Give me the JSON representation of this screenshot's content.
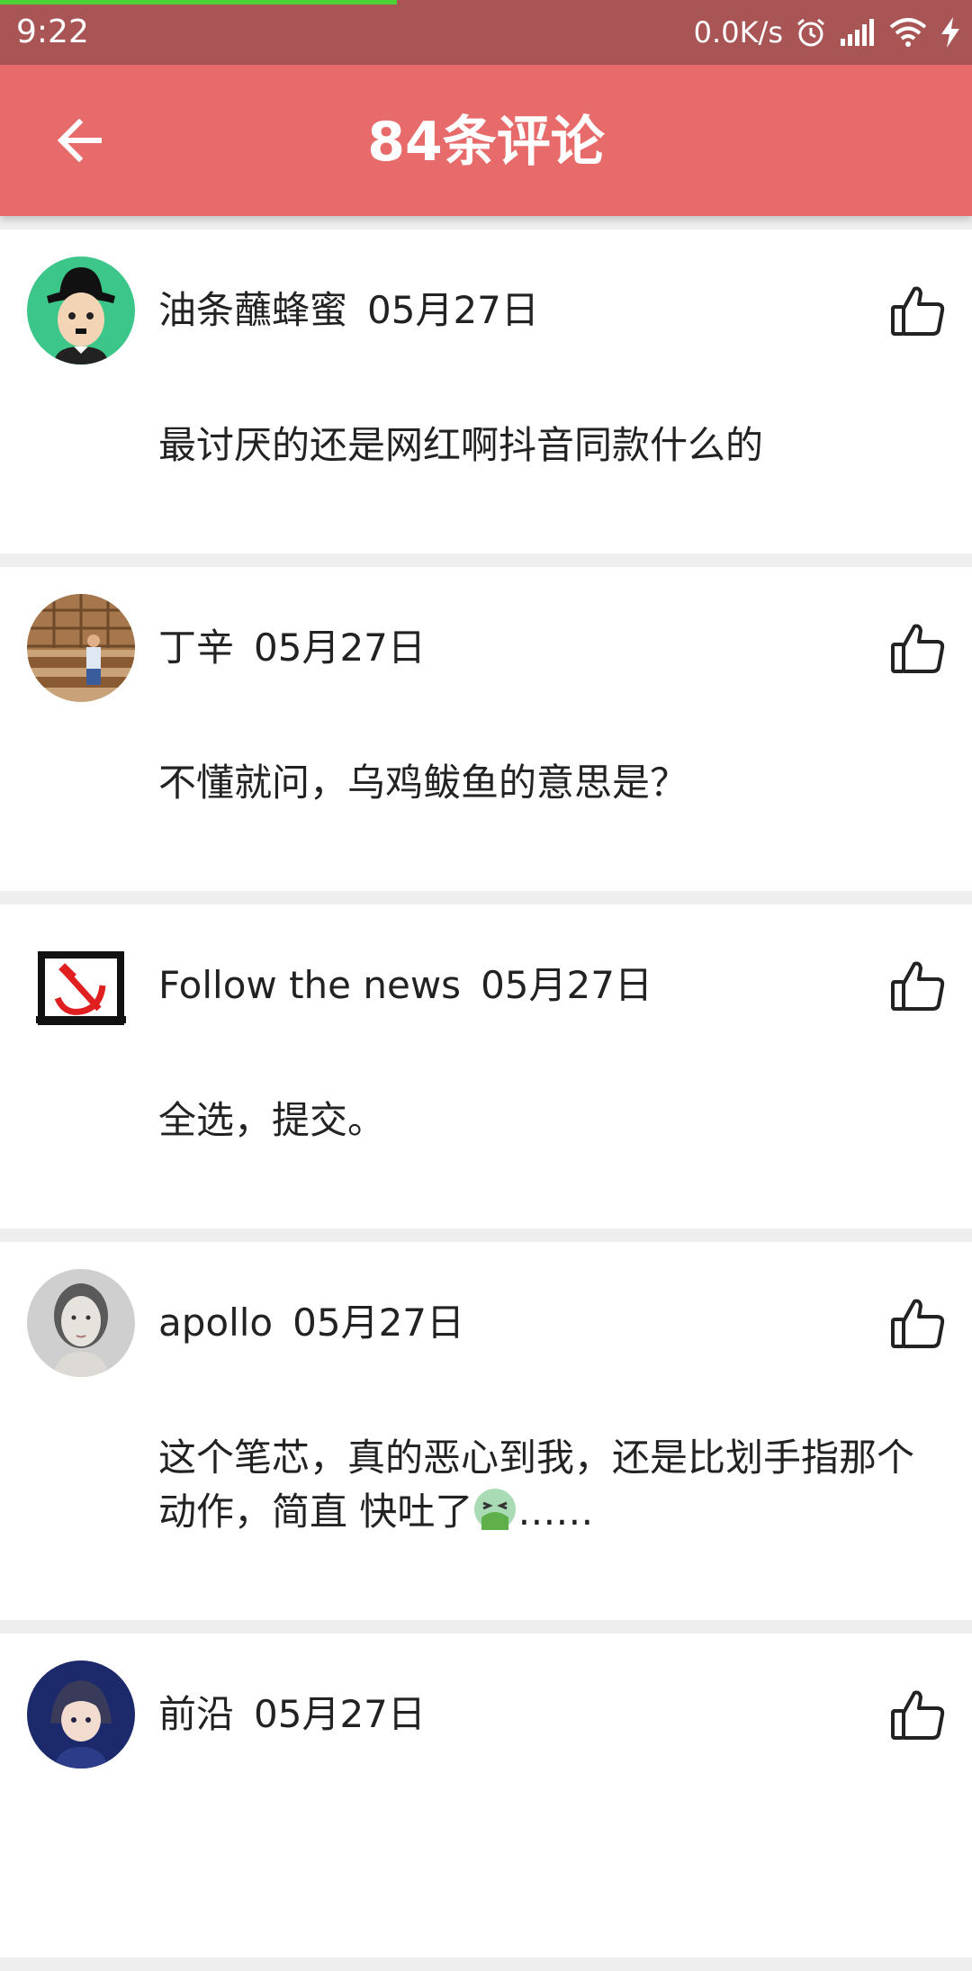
{
  "status_bar": {
    "time": "9:22",
    "net_speed": "0.0K/s",
    "icons": [
      "alarm-icon",
      "signal-icon",
      "wifi-icon",
      "charging-icon"
    ],
    "background": "#a95555"
  },
  "app_bar": {
    "title": "84条评论",
    "back_icon": "arrow-left-icon",
    "background": "#e76b6b"
  },
  "comments": [
    {
      "user": "油条蘸蜂蜜",
      "date": "05月27日",
      "text": "最讨厌的还是网红啊抖音同款什么的",
      "avatar": "cartoon-man-avatar"
    },
    {
      "user": "丁辛",
      "date": "05月27日",
      "text": "不懂就问，乌鸡鲅鱼的意思是？",
      "avatar": "bookshelf-photo-avatar"
    },
    {
      "user": "Follow the news",
      "date": "05月27日",
      "text": "全选，提交。",
      "avatar": "hammer-sickle-logo-avatar"
    },
    {
      "user": "apollo",
      "date": "05月27日",
      "text": "这个笔芯，真的恶心到我，还是比划手指那个动作，简直 快吐了",
      "text_suffix": "……",
      "emoji": "vomiting-face-emoji",
      "avatar": "woman-portrait-avatar"
    },
    {
      "user": "前沿",
      "date": "05月27日",
      "text": "",
      "avatar": "anime-character-avatar"
    }
  ]
}
